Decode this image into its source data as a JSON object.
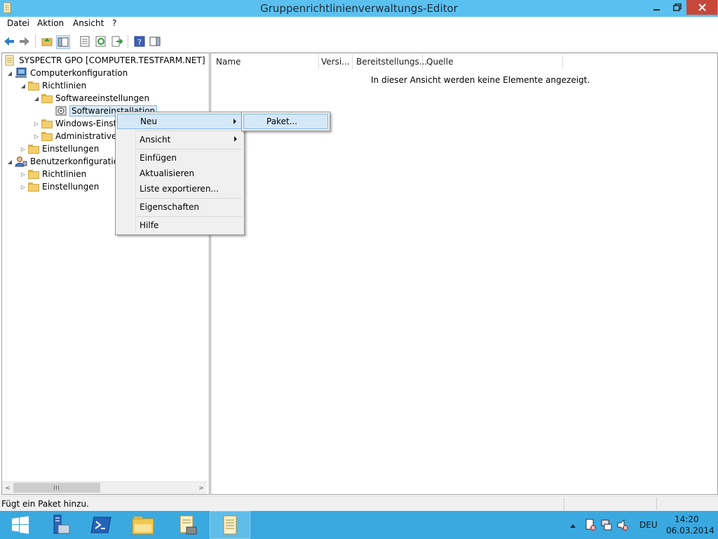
{
  "window": {
    "title": "Gruppenrichtlinienverwaltungs-Editor"
  },
  "menubar": {
    "items": [
      "Datei",
      "Aktion",
      "Ansicht",
      "?"
    ]
  },
  "toolbar": {
    "icons": [
      "back-arrow-icon",
      "forward-arrow-icon",
      "up-folder-icon",
      "show-hide-tree-icon",
      "properties-icon",
      "refresh-icon",
      "export-list-icon",
      "help-icon",
      "show-hide-action-pane-icon"
    ]
  },
  "tree": {
    "root": "SYSPECTR GPO [COMPUTER.TESTFARM.NET]",
    "computer_config": "Computerkonfiguration",
    "richtlinien": "Richtlinien",
    "softwareeinstellungen": "Softwareeinstellungen",
    "softwareinstallation": "Softwareinstallation",
    "windows_einst": "Windows-Einste",
    "administrative": "Administrative",
    "einstellungen": "Einstellungen",
    "benutzer_config": "Benutzerkonfiguration",
    "user_richtlinien": "Richtlinien",
    "user_einstellungen": "Einstellungen"
  },
  "list": {
    "columns": [
      "Name",
      "Versi...",
      "Bereitstellungs...",
      "Quelle"
    ],
    "empty_message": "In dieser Ansicht werden keine Elemente angezeigt."
  },
  "context_menu": {
    "items": [
      "Neu",
      "Ansicht",
      "Einfügen",
      "Aktualisieren",
      "Liste exportieren...",
      "Eigenschaften",
      "Hilfe"
    ],
    "submenu_item": "Paket..."
  },
  "status": {
    "text": "Fügt ein Paket hinzu."
  },
  "taskbar": {
    "language": "DEU",
    "time": "14:20",
    "date": "06.03.2014"
  },
  "colors": {
    "titlebar": "#5ac0f0",
    "taskbar": "#3aa9e0",
    "close_button": "#c7483a",
    "highlight": "#d5e8f8"
  }
}
